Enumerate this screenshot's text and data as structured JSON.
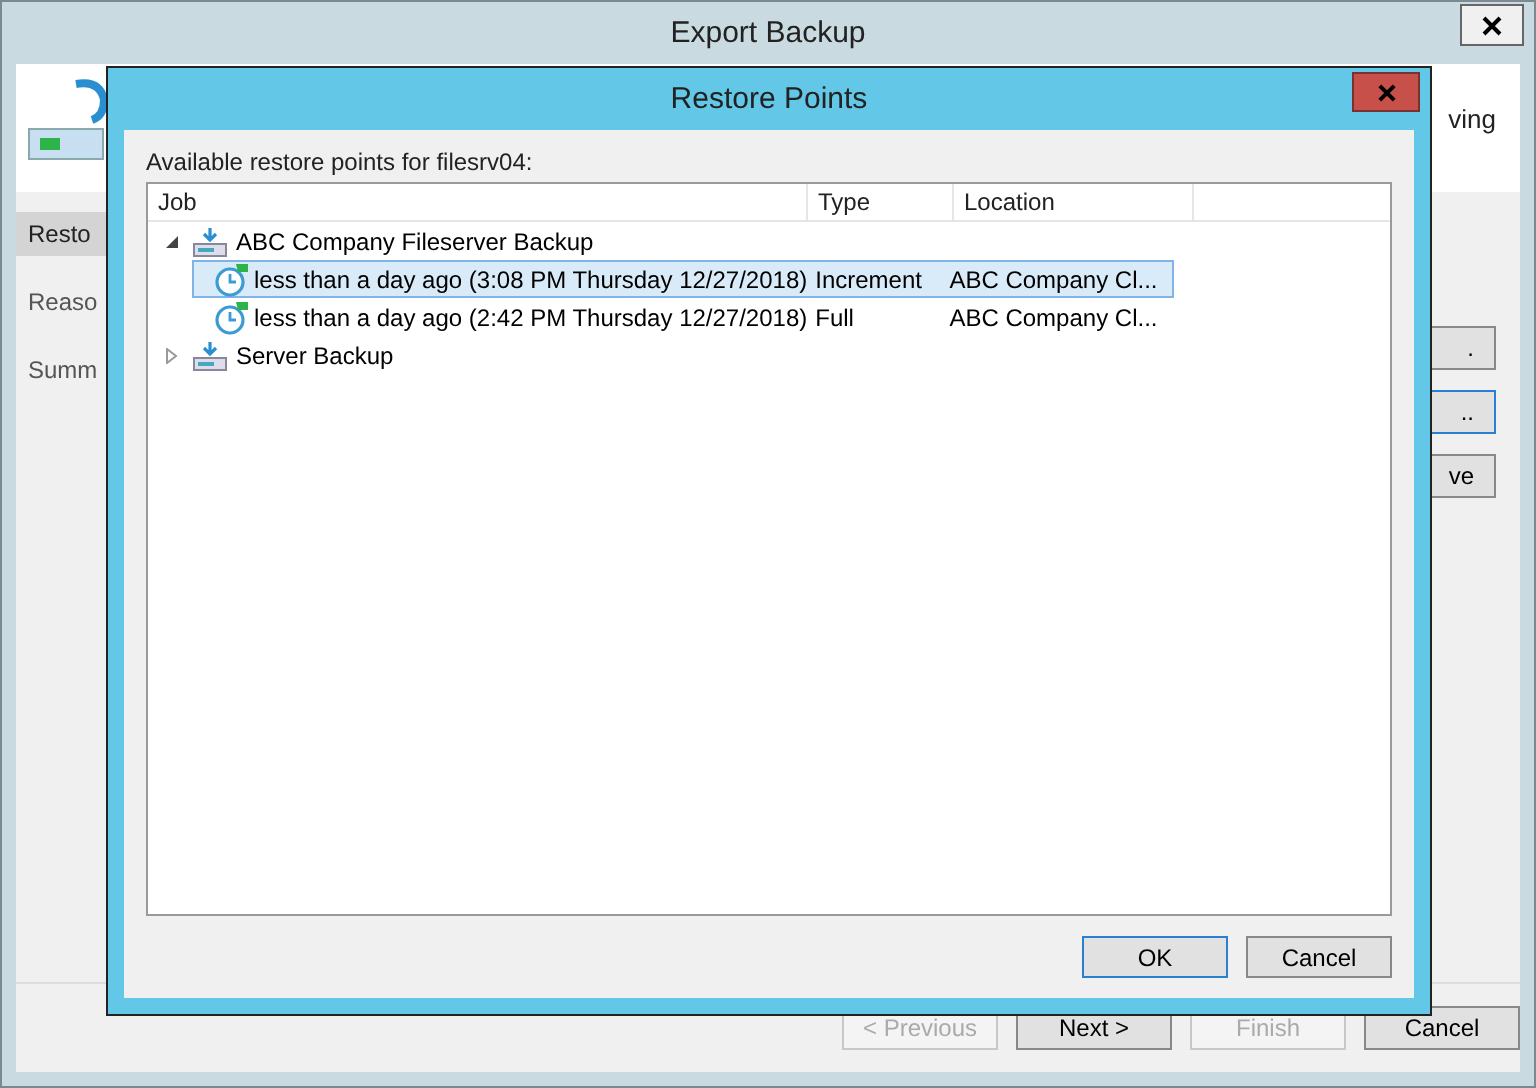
{
  "window": {
    "title": "Export Backup"
  },
  "wizard": {
    "header_text": "ving",
    "steps": [
      {
        "label": "Resto",
        "selected": true
      },
      {
        "label": "Reaso",
        "selected": false
      },
      {
        "label": "Summ",
        "selected": false
      }
    ],
    "side_buttons": [
      {
        "label": ".",
        "focused": false
      },
      {
        "label": "..",
        "focused": true
      },
      {
        "label": "ve",
        "focused": false
      }
    ],
    "buttons": [
      {
        "label": "< Previous",
        "disabled": true
      },
      {
        "label": "Next >",
        "disabled": false
      },
      {
        "label": "Finish",
        "disabled": true
      },
      {
        "label": "Cancel",
        "disabled": false
      }
    ]
  },
  "dialog": {
    "title": "Restore Points",
    "prompt": "Available restore points for filesrv04:",
    "columns": [
      "Job",
      "Type",
      "Location"
    ],
    "jobs": [
      {
        "name": "ABC Company Fileserver Backup",
        "expanded": true,
        "children": [
          {
            "name": "less than a day ago (3:08 PM Thursday 12/27/2018)",
            "type": "Increment",
            "location": "ABC Company Cl...",
            "selected": true
          },
          {
            "name": "less than a day ago (2:42 PM Thursday 12/27/2018)",
            "type": "Full",
            "location": "ABC Company Cl...",
            "selected": false
          }
        ]
      },
      {
        "name": "Server Backup",
        "expanded": false
      }
    ],
    "buttons": [
      {
        "label": "OK",
        "default": true
      },
      {
        "label": "Cancel",
        "default": false
      }
    ]
  }
}
